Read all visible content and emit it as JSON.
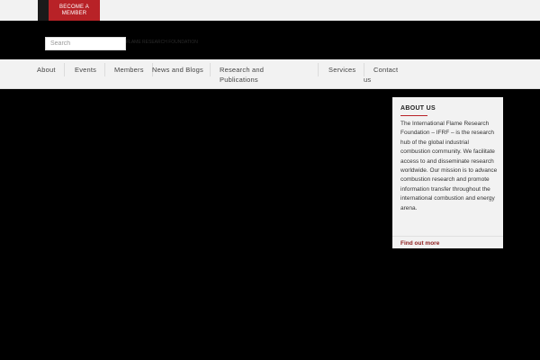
{
  "topbar": {
    "member_button_label": "BECOME A MEMBER"
  },
  "header": {
    "search_placeholder": "Search",
    "tagline": "FLAME RESEARCH FOUNDATION"
  },
  "nav": {
    "items": [
      {
        "label": "About"
      },
      {
        "label": "Events"
      },
      {
        "label": "Members"
      },
      {
        "label": "News and Blogs"
      },
      {
        "label": "Research and Publications"
      },
      {
        "label": "Services"
      },
      {
        "label": "Contact us"
      }
    ]
  },
  "about": {
    "title": "ABOUT US",
    "text": "The International Flame Research Foundation – IFRF – is the research hub of the global industrial combustion community. We facilitate access to and disseminate research worldwide. Our mission is to advance combustion research and promote information transfer throughout the international combustion and energy arena.",
    "link_label": "Find out more"
  },
  "colors": {
    "accent": "#b82227",
    "link": "#8b1a1a",
    "page_background": "#000000",
    "bar_background": "#f2f2f2"
  }
}
